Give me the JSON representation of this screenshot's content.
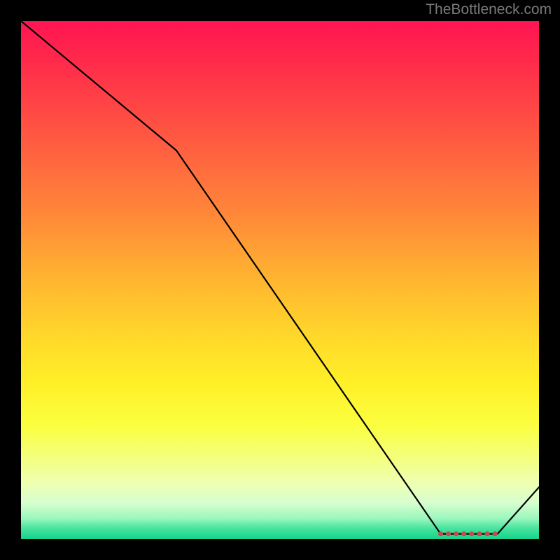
{
  "attribution": "TheBottleneck.com",
  "chart_data": {
    "type": "line",
    "title": "",
    "xlabel": "",
    "ylabel": "",
    "xlim": [
      0,
      100
    ],
    "ylim": [
      0,
      100
    ],
    "x": [
      0,
      30,
      81,
      92,
      100
    ],
    "values": [
      100,
      75,
      1,
      1,
      10
    ],
    "optimal_range_x": [
      81,
      92
    ],
    "optimal_range_y": 1,
    "background_gradient": {
      "top": "#ff1452",
      "mid": "#ffdb2a",
      "bottom": "#14d48f"
    }
  }
}
